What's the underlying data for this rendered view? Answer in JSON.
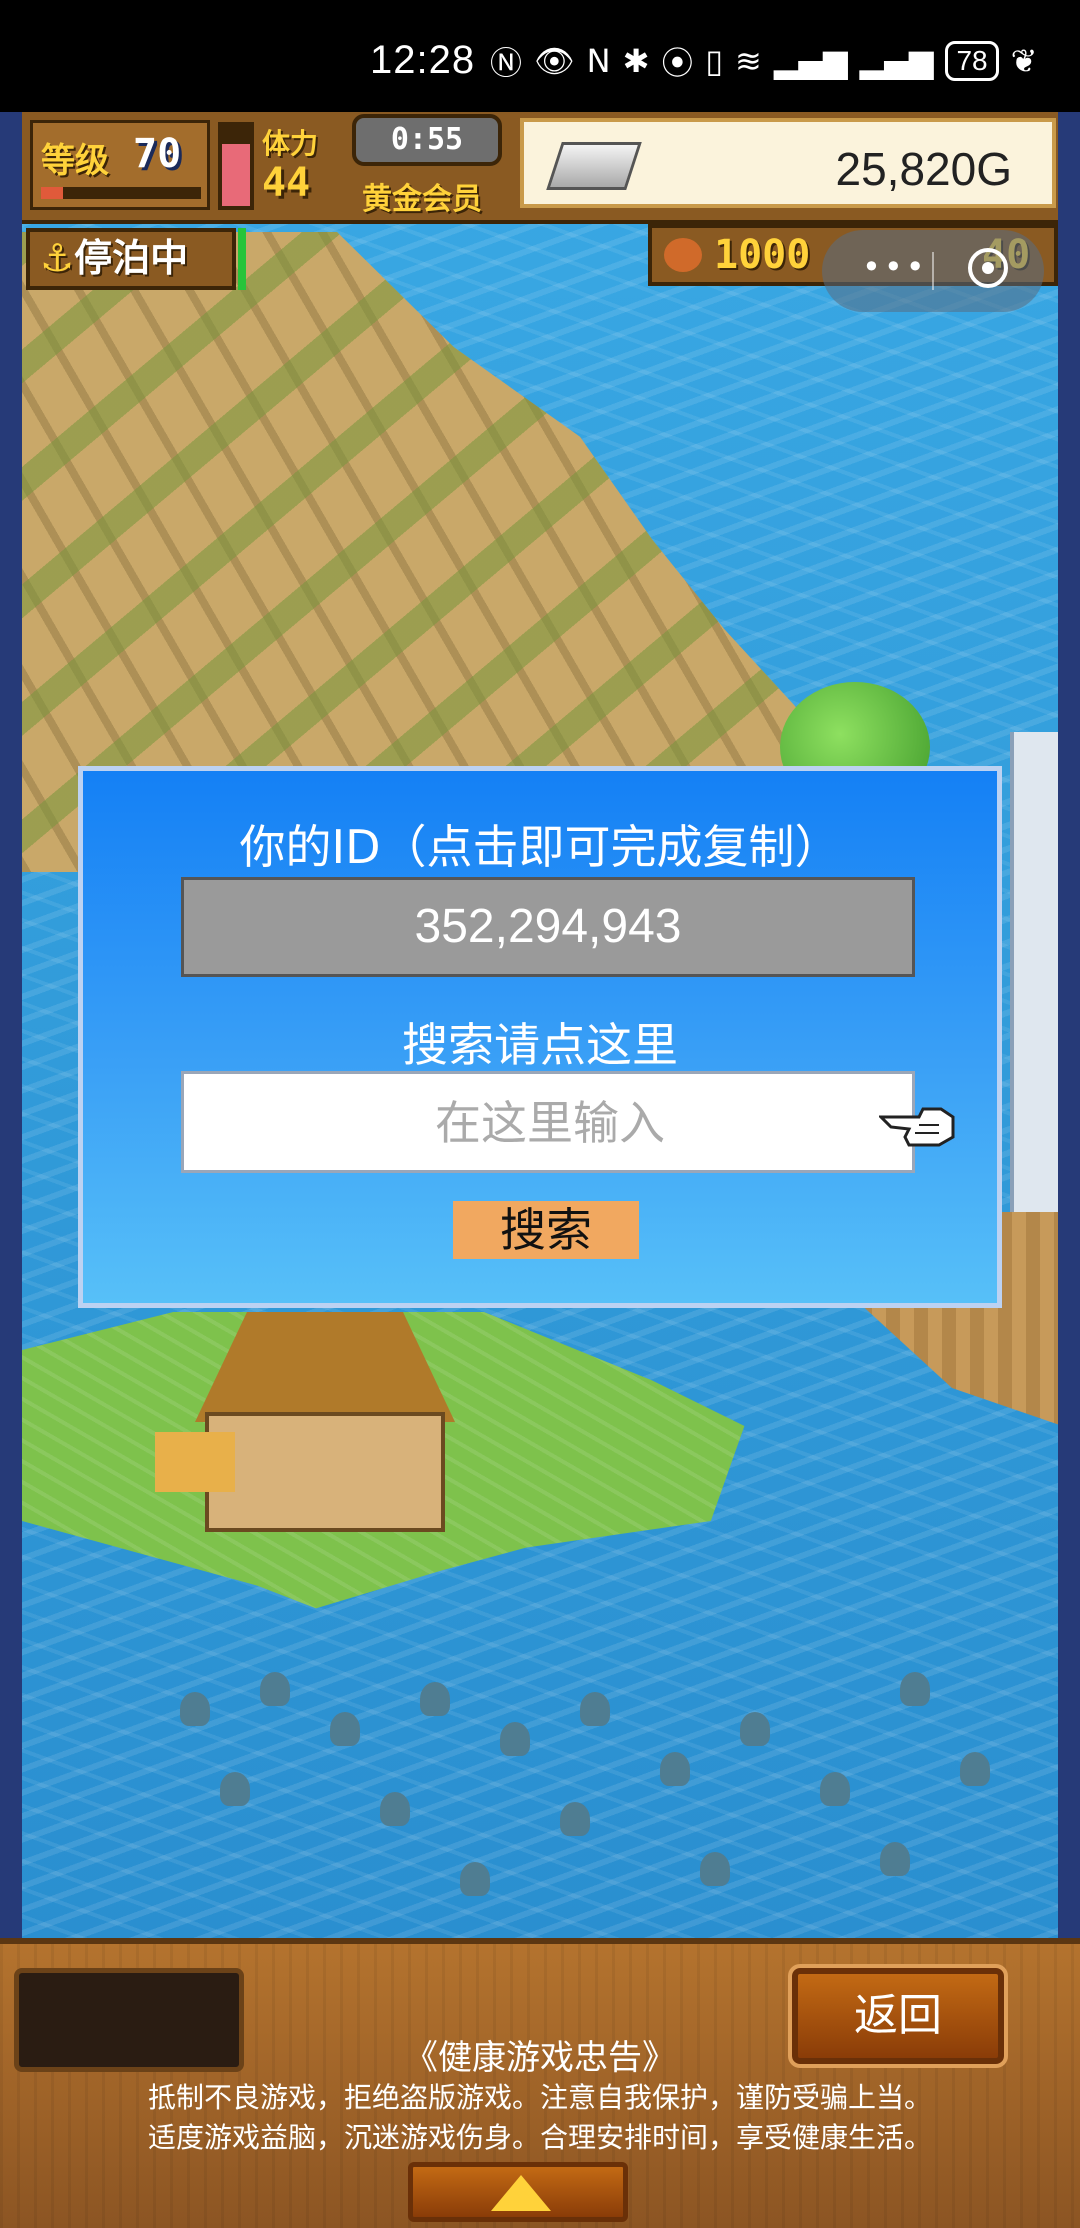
{
  "status_bar": {
    "time": "12:28",
    "battery": "78",
    "icons": [
      "nfc-icon",
      "eye-icon",
      "nfc-n-icon",
      "bluetooth-icon",
      "location-icon",
      "vibrate-icon",
      "wifi-icon",
      "signal-4g-icon",
      "signal-4g-icon",
      "battery-icon",
      "leaf-icon"
    ]
  },
  "hud": {
    "level_label": "等级",
    "level_value": "70",
    "stamina_label": "体力",
    "stamina_value": "44",
    "timer": "0:55",
    "member_label": "黄金会员",
    "gold": "25,820G",
    "anchor_status": "停泊中",
    "resource_value_1": "1000",
    "resource_value_2": "40"
  },
  "dialog": {
    "title": "你的ID（点击即可完成复制）",
    "user_id": "352,294,943",
    "search_label": "搜索请点这里",
    "search_placeholder": "在这里输入",
    "search_button": "搜索"
  },
  "bottom": {
    "back_button": "返回",
    "notice_title": "《健康游戏忠告》",
    "notice_line1": "抵制不良游戏，拒绝盗版游戏。注意自我保护，谨防受骗上当。",
    "notice_line2": "适度游戏益脑，沉迷游戏伤身。合理安排时间，享受健康生活。"
  },
  "colors": {
    "dialog_bg_top": "#1480f5",
    "dialog_bg_bottom": "#57c0f8",
    "search_button_bg": "#f1a860",
    "id_box_bg": "#9a9a9a",
    "hud_wood": "#8a5a22",
    "gold_text": "#ffd23a"
  }
}
